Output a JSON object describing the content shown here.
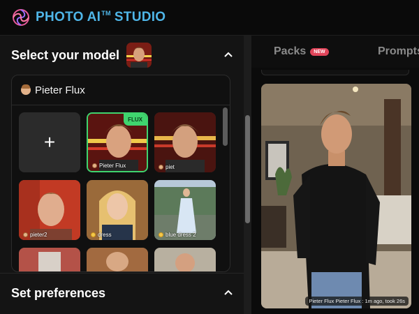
{
  "brand": {
    "name": "PHOTO AI",
    "tm": "TM",
    "suffix": "STUDIO",
    "accent": "#4fb6e8"
  },
  "model_section": {
    "title": "Select your model",
    "selected_model": "Pieter Flux",
    "add_icon": "plus-icon",
    "models": [
      {
        "label": "Pieter Flux",
        "badge": "FLUX",
        "selected": true
      },
      {
        "label": "piet",
        "selected": false
      },
      {
        "label": "pieter2",
        "selected": false
      },
      {
        "label": "dress",
        "selected": false
      },
      {
        "label": "blue dress 2",
        "selected": false
      }
    ]
  },
  "preferences_section": {
    "title": "Set preferences"
  },
  "tabs": [
    {
      "label": "Packs",
      "badge": "NEW"
    },
    {
      "label": "Prompts"
    }
  ],
  "photo": {
    "caption": "Pieter Flux Pieter Flux : 1m ago, took 26s"
  },
  "colors": {
    "selected_border": "#3fd46e",
    "new_badge": "#e0455a"
  }
}
